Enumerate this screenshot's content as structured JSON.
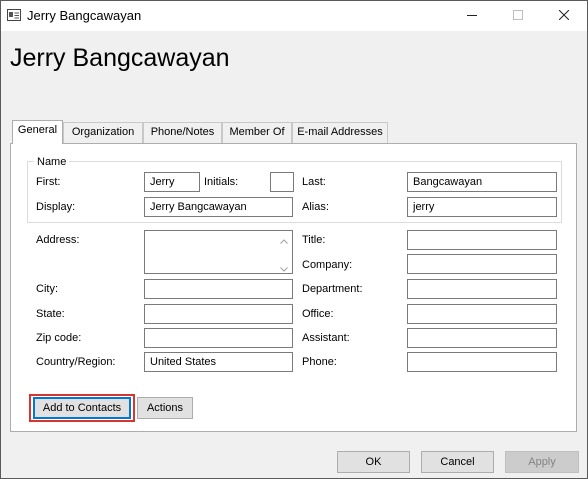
{
  "window": {
    "title": "Jerry Bangcawayan",
    "heading": "Jerry Bangcawayan",
    "icons": {
      "app": "contact-card-icon",
      "minimize": "minimize-icon",
      "maximize": "maximize-icon",
      "close": "close-icon"
    }
  },
  "tabs": [
    {
      "label": "General",
      "active": true
    },
    {
      "label": "Organization",
      "active": false
    },
    {
      "label": "Phone/Notes",
      "active": false
    },
    {
      "label": "Member Of",
      "active": false
    },
    {
      "label": "E-mail Addresses",
      "active": false
    }
  ],
  "name_group": {
    "legend": "Name",
    "first_label": "First:",
    "first_value": "Jerry",
    "initials_label": "Initials:",
    "initials_value": "",
    "last_label": "Last:",
    "last_value": "Bangcawayan",
    "display_label": "Display:",
    "display_value": "Jerry Bangcawayan",
    "alias_label": "Alias:",
    "alias_value": "jerry"
  },
  "address": {
    "address_label": "Address:",
    "address_value": "",
    "city_label": "City:",
    "city_value": "",
    "state_label": "State:",
    "state_value": "",
    "zip_label": "Zip code:",
    "zip_value": "",
    "country_label": "Country/Region:",
    "country_value": "United States"
  },
  "work": {
    "title_label": "Title:",
    "title_value": "",
    "company_label": "Company:",
    "company_value": "",
    "department_label": "Department:",
    "department_value": "",
    "office_label": "Office:",
    "office_value": "",
    "assistant_label": "Assistant:",
    "assistant_value": "",
    "phone_label": "Phone:",
    "phone_value": ""
  },
  "actions": {
    "add_to_contacts": "Add to Contacts",
    "actions": "Actions"
  },
  "footer": {
    "ok": "OK",
    "cancel": "Cancel",
    "apply": "Apply"
  },
  "colors": {
    "highlight_border": "#d9352e",
    "focus_border": "#0078d7"
  }
}
